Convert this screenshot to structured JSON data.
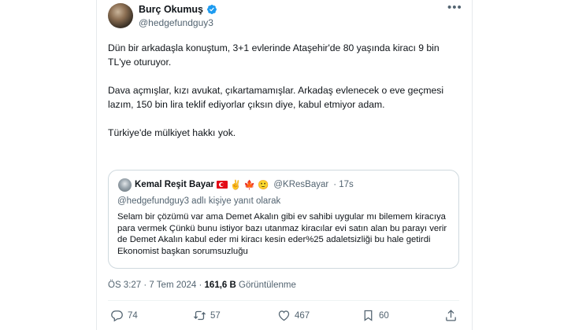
{
  "author": {
    "display_name": "Burç Okumuş",
    "handle": "@hedgefundguy3",
    "verified": true,
    "verified_color": "#1d9bf0"
  },
  "tweet": {
    "paragraphs": [
      "Dün bir arkadaşla konuştum, 3+1 evlerinde Ataşehir'de 80 yaşında kiracı 9 bin TL'ye oturuyor.",
      "Dava açmışlar, kızı avukat, çıkartamamışlar. Arkadaş evlenecek o eve geçmesi lazım, 150 bin lira teklif ediyorlar çıksın diye, kabul etmiyor adam.",
      "Türkiye'de mülkiyet hakkı yok."
    ]
  },
  "quote": {
    "display_name": "Kemal Reşit Bayar",
    "emojis": "✌️ 🍁 🙂",
    "handle": "@KResBayar",
    "time": "· 17s",
    "reply_context": "@hedgefundguy3 adlı kişiye yanıt olarak",
    "text": "Selam bir çözümü var ama Demet Akalın gibi ev sahibi uygular mı bilemem kiracıya para vermek Çünkü bunu istiyor bazı utanmaz kiracılar evi satın alan bu parayı verir de Demet Akalın kabul eder mi kiracı kesin eder%25 adaletsizliği bu hale getirdi Ekonomist başkan sorumsuzluğu"
  },
  "meta": {
    "time": "ÖS 3:27 · 7 Tem 2024 · ",
    "views_count": "161,6 B",
    "views_label": " Görüntülenme"
  },
  "actions": {
    "replies": "74",
    "retweets": "57",
    "likes": "467",
    "bookmarks": "60"
  },
  "colors": {
    "text_primary": "#0f1419",
    "text_secondary": "#536471",
    "border": "#cfd9de"
  }
}
